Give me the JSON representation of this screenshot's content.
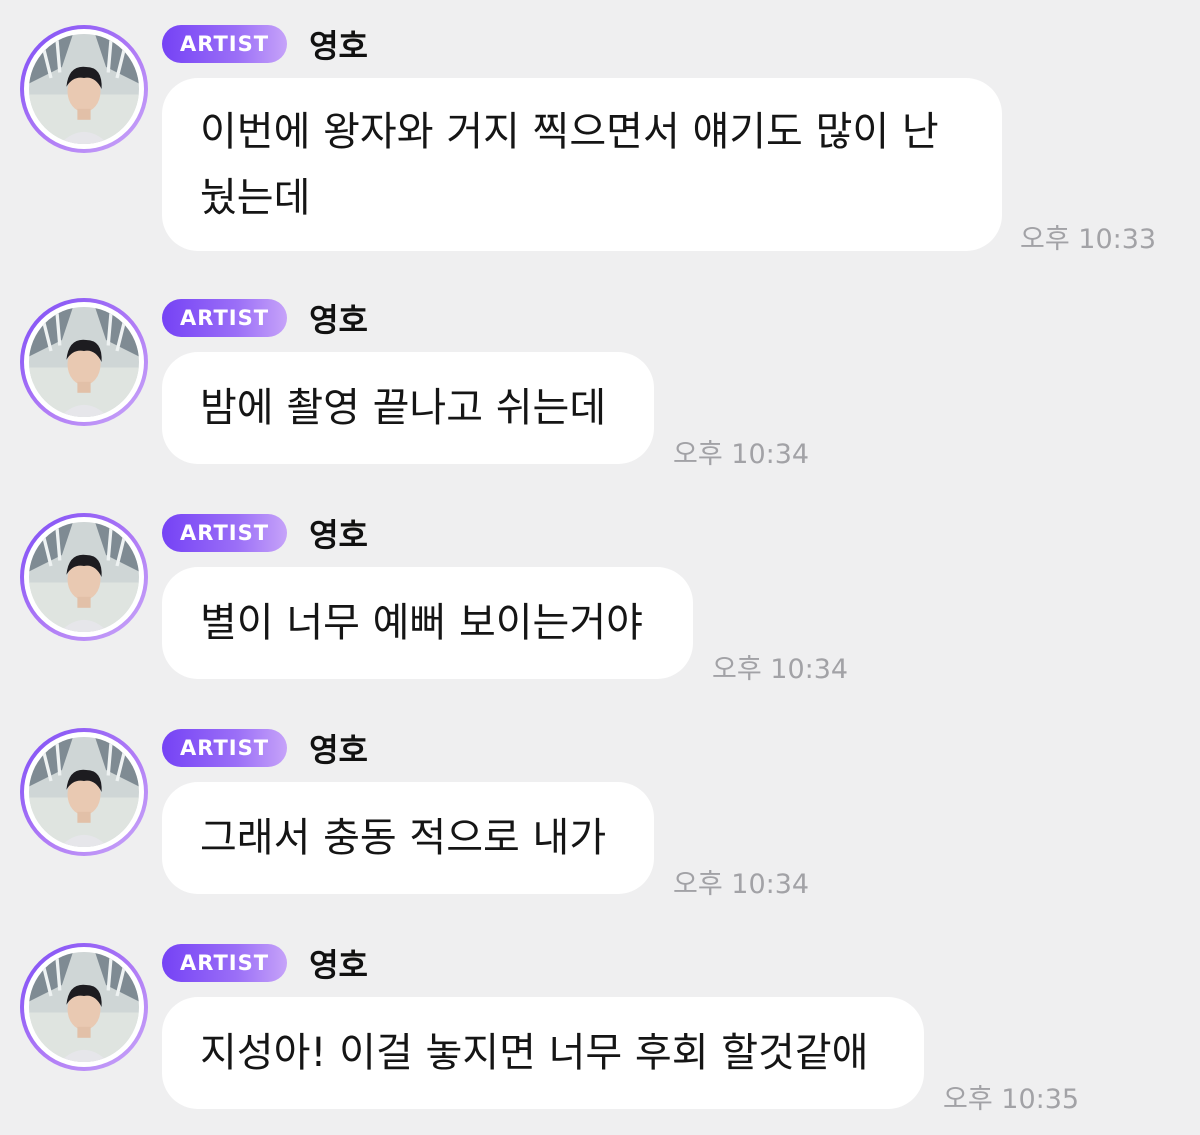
{
  "messages": [
    {
      "badge": "ARTIST",
      "sender": "영호",
      "text": "이번에 왕자와 거지 찍으면서 얘기도 많이 난\n눴는데",
      "time": "오후 10:33"
    },
    {
      "badge": "ARTIST",
      "sender": "영호",
      "text": "밤에 촬영 끝나고 쉬는데",
      "time": "오후 10:34"
    },
    {
      "badge": "ARTIST",
      "sender": "영호",
      "text": "별이 너무 예뻐 보이는거야",
      "time": "오후 10:34"
    },
    {
      "badge": "ARTIST",
      "sender": "영호",
      "text": "그래서 충동 적으로 내가",
      "time": "오후 10:34"
    },
    {
      "badge": "ARTIST",
      "sender": "영호",
      "text": "지성아! 이걸 놓지면 너무 후회 할것같애",
      "time": "오후 10:35"
    }
  ],
  "colors": {
    "background": "#efeff0",
    "badge_start": "#7542f5",
    "badge_end": "#c6a3f9",
    "bubble": "#ffffff",
    "timestamp": "#a2a2a6"
  },
  "icons": {
    "avatar": "profile-photo"
  }
}
